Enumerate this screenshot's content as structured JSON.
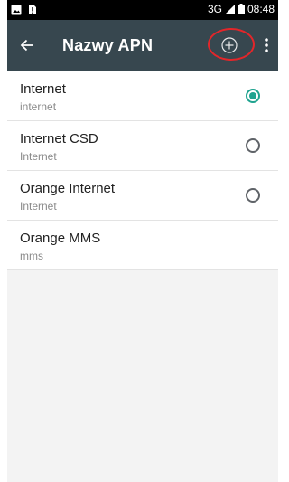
{
  "status_bar": {
    "network": "3G",
    "time": "08:48",
    "icons": [
      "image-notification-icon",
      "alert-notification-icon",
      "signal-icon",
      "battery-icon"
    ]
  },
  "toolbar": {
    "title": "Nazwy APN",
    "icons": [
      "back-arrow-icon",
      "add-circle-icon",
      "overflow-menu-icon"
    ],
    "background": "#37474f"
  },
  "highlight_color": "#e3262a",
  "accent": "#1fa38f",
  "apns": [
    {
      "name": "Internet",
      "apn": "internet",
      "selectable": true,
      "selected": true
    },
    {
      "name": "Internet CSD",
      "apn": "Internet",
      "selectable": true,
      "selected": false
    },
    {
      "name": "Orange Internet",
      "apn": "Internet",
      "selectable": true,
      "selected": false
    },
    {
      "name": "Orange MMS",
      "apn": "mms",
      "selectable": false,
      "selected": false
    }
  ]
}
